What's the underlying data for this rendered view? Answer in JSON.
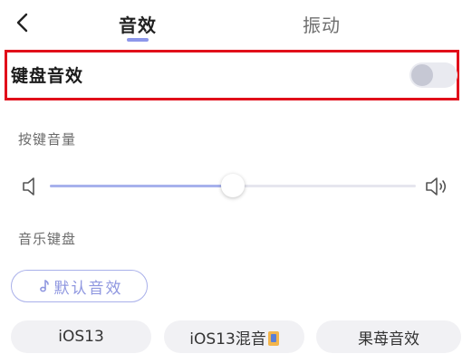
{
  "header": {
    "tabs": [
      {
        "label": "音效",
        "active": true
      },
      {
        "label": "振动",
        "active": false
      }
    ]
  },
  "keyboard_sound": {
    "label": "键盘音效",
    "enabled": false
  },
  "key_volume": {
    "label": "按键音量",
    "level": 0.5
  },
  "music_keyboard": {
    "label": "音乐键盘",
    "selected_option": "默认音效",
    "options": [
      "iOS13",
      "iOS13混音",
      "果苺音效"
    ]
  },
  "colors": {
    "accent": "#8d97ea",
    "highlight_border": "#e10f1a"
  },
  "icons": [
    "back-arrow-icon",
    "music-note-icon",
    "volume-low-icon",
    "volume-high-icon",
    "phone-emoji-icon"
  ]
}
